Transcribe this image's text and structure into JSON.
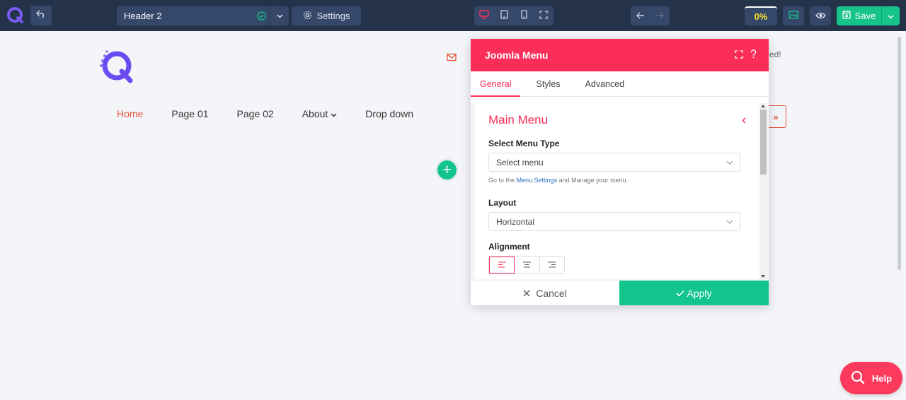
{
  "toolbar": {
    "layout_select": {
      "value": "Header 2"
    },
    "settings_label": "Settings",
    "progress": "0%",
    "save_label": "Save"
  },
  "site": {
    "nav": [
      {
        "label": "Home",
        "active": true
      },
      {
        "label": "Page 01"
      },
      {
        "label": "Page 02"
      },
      {
        "label": "About",
        "has_dropdown": true
      },
      {
        "label": "Drop down"
      }
    ],
    "partial_text": "ed!",
    "toggle_glyph": "»",
    "add_glyph": "+"
  },
  "modal": {
    "title": "Joomla Menu",
    "tabs": [
      {
        "label": "General",
        "active": true
      },
      {
        "label": "Styles"
      },
      {
        "label": "Advanced"
      }
    ],
    "section_title": "Main Menu",
    "menu_type": {
      "label": "Select Menu Type",
      "value": "Select menu",
      "help_prefix": "Go to the ",
      "help_link": "Menu Settings",
      "help_suffix": " and Manage your menu."
    },
    "layout": {
      "label": "Layout",
      "value": "Horizontal"
    },
    "alignment": {
      "label": "Alignment",
      "selected": "left"
    },
    "cancel_label": "Cancel",
    "apply_label": "Apply"
  },
  "help_label": "Help",
  "colors": {
    "toolbar_bg": "#243349",
    "accent_pink": "#fb2e5a",
    "accent_green": "#13c58d",
    "nav_active": "#e5533c",
    "logo_purple": "#6a4cf0"
  }
}
